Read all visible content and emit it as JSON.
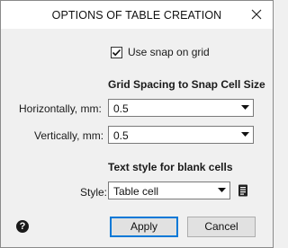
{
  "window": {
    "title": "OPTIONS OF TABLE CREATION",
    "close_icon": "close-icon"
  },
  "snap": {
    "label": "Use snap on grid",
    "checked": true
  },
  "grid": {
    "heading": "Grid Spacing to Snap Cell Size",
    "horizontal_label": "Horizontally, mm:",
    "horizontal_value": "0.5",
    "vertical_label": "Vertically, mm:",
    "vertical_value": "0.5"
  },
  "text_style": {
    "heading": "Text style for blank cells",
    "style_label": "Style:",
    "style_value": "Table cell",
    "style_icon": "text-style-icon"
  },
  "buttons": {
    "help_glyph": "?",
    "apply": "Apply",
    "cancel": "Cancel"
  },
  "colors": {
    "primary_border": "#0078d7",
    "dialog_bg": "#f0f0f0",
    "titlebar_bg": "#ffffff"
  }
}
